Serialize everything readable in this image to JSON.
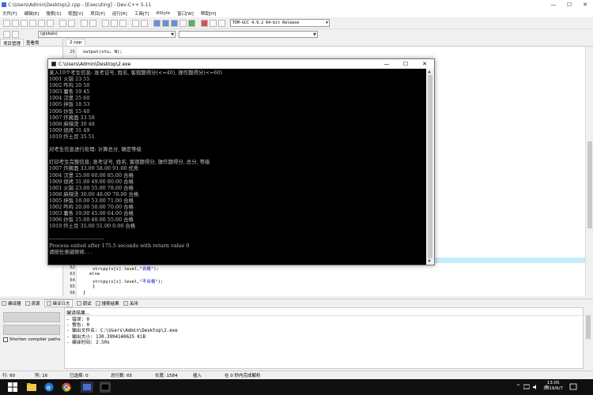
{
  "window": {
    "title": "C:\\Users\\Admin\\Desktop\\2.cpp - [Executing] - Dev-C++ 5.11",
    "min": "—",
    "max": "☐",
    "close": "✕"
  },
  "menu": [
    "文件[F]",
    "编辑[E]",
    "搜索[S]",
    "视图[V]",
    "项目[P]",
    "运行[R]",
    "工具[T]",
    "AStyle",
    "窗口[W]",
    "帮助[H]"
  ],
  "toolbar": {
    "compiler": "TDM-GCC 4.9.2 64-bit Release",
    "scope": "(globals)"
  },
  "left_tabs": [
    "项目管理",
    "查看类"
  ],
  "editor": {
    "tab": "2.cpp",
    "top_line_no": "25",
    "top_line_code": "output(stu, N);",
    "lines": [
      {
        "no": "62",
        "code_a": "strcpy(s[i].level,",
        "code_b": "\"合格\"",
        "code_c": ");"
      },
      {
        "no": "63",
        "code_a": "else",
        "code_b": "",
        "code_c": ""
      },
      {
        "no": "64",
        "code_a": "strcpy(s[i].level,",
        "code_b": "\"不合格\"",
        "code_c": ");"
      },
      {
        "no": "65",
        "code_a": "}",
        "code_b": "",
        "code_c": ""
      },
      {
        "no": "66",
        "code_a": "}",
        "code_b": "",
        "code_c": ""
      }
    ]
  },
  "console": {
    "title": "C:\\Users\\Admin\\Desktop\\2.exe",
    "lines": [
      "录入10个考生信息: 准考证号, 姓名, 客观题得分(<=40), 操作题得分(<=60)",
      "1001 火锅 23 55",
      "1002 咋鸡 20 50",
      "1003 薯条 19 45",
      "1004 汉堡 25 60",
      "1005 拌饭 18 53",
      "1006 炒饭 15 40",
      "1007 炸酱面 33 58",
      "1008 麻辣烫 30 48",
      "1009 烧烤 31 49",
      "1010 炸土豆 35 51",
      "",
      "对考生信息进行处理: 计算总分, 确定等级",
      "",
      "打印考生完整信息: 准考证号, 姓名, 客观题得分, 操作题得分, 总分, 等级",
      "1007 炸酱面 33.00 58.00 91.00 优秀",
      "1004 汉堡 25.00 60.00 85.00 合格",
      "1009 烧烤 31.00 49.00 80.00 合格",
      "1001 火锅 23.00 55.00 78.00 合格",
      "1008 麻辣烫 30.00 48.00 78.00 合格",
      "1005 拌饭 18.00 53.00 71.00 合格",
      "1002 咋鸡 20.00 50.00 70.00 合格",
      "1003 薯条 19.00 45.00 64.00 合格",
      "1006 炒饭 15.00 40.00 55.00 合格",
      "1010 炸土豆 35.00 51.00 0.00 合格",
      "",
      "--------------------------------",
      "Process exited after 175.5 seconds with return value 0",
      "请按任意键继续. . ."
    ]
  },
  "bottom_tabs": [
    "编译器",
    "资源",
    "编译日志",
    "调试",
    "搜索结果",
    "关闭"
  ],
  "shorten_label": "Shorten compiler paths",
  "compile": {
    "header": "编译结果...",
    "lines": [
      "- 错误: 0",
      "- 警告: 0",
      "- 输出文件名: C:\\Users\\Admin\\Desktop\\2.exe",
      "- 输出大小: 130.3994140625 KiB",
      "- 编译时间: 2.50s"
    ]
  },
  "status": {
    "row": "行: 60",
    "col": "列: 16",
    "selected": "已选择: 0",
    "total": "总行数: 65",
    "length": "长度: 1584",
    "insert": "插入",
    "parse": "在 0 秒内完成解析"
  },
  "taskbar": {
    "time": "13:05",
    "date": "2019/6/7"
  }
}
